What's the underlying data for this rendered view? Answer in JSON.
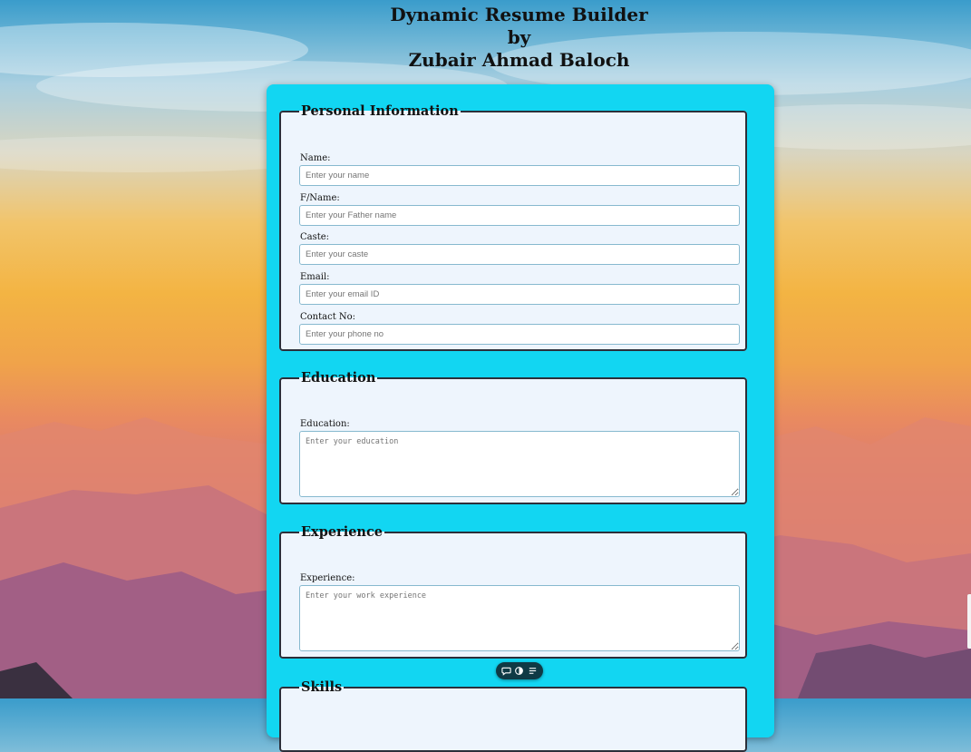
{
  "header": {
    "line1": "Dynamic Resume Builder",
    "line2": "by",
    "line3": "Zubair Ahmad Baloch"
  },
  "sections": {
    "personal": {
      "legend": "Personal Information",
      "fields": [
        {
          "label": "Name:",
          "placeholder": "Enter your name"
        },
        {
          "label": "F/Name:",
          "placeholder": "Enter your Father name"
        },
        {
          "label": "Caste:",
          "placeholder": "Enter your caste"
        },
        {
          "label": "Email:",
          "placeholder": "Enter your email ID"
        },
        {
          "label": "Contact No:",
          "placeholder": "Enter your phone no"
        }
      ]
    },
    "education": {
      "legend": "Education",
      "label": "Education:",
      "placeholder": "Enter your education"
    },
    "experience": {
      "legend": "Experience",
      "label": "Experience:",
      "placeholder": "Enter your work experience"
    },
    "skills": {
      "legend": "Skills"
    }
  },
  "toolbar": {
    "icons": [
      "comment-icon",
      "contrast-icon",
      "list-icon"
    ]
  },
  "colors": {
    "container_bg": "#12d6f2",
    "fieldset_bg": "#eef5fd",
    "fieldset_border": "#2b2f3a",
    "input_border": "#87b9cf"
  }
}
